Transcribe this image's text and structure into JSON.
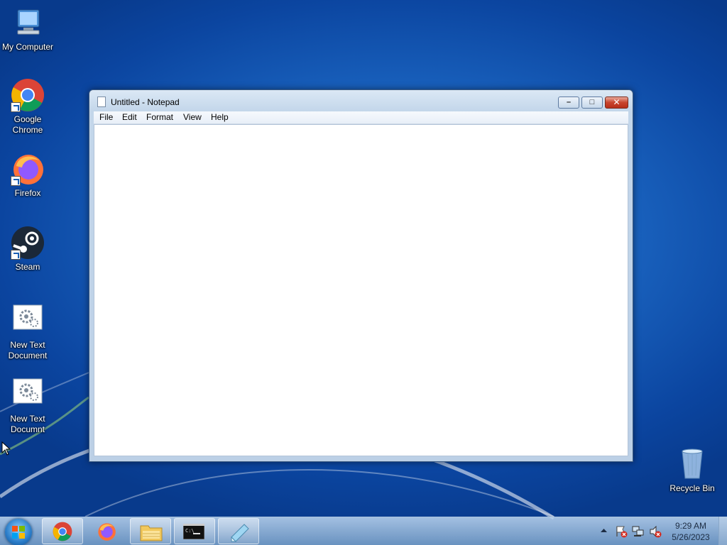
{
  "desktop": {
    "icons": [
      {
        "label": "My Computer"
      },
      {
        "label": "Google Chrome"
      },
      {
        "label": "Firefox"
      },
      {
        "label": "Steam"
      },
      {
        "label": "New Text Document"
      },
      {
        "label": "New Text Documnt"
      },
      {
        "label": "Recycle Bin"
      }
    ]
  },
  "notepad": {
    "title": "Untitled - Notepad",
    "menu": [
      "File",
      "Edit",
      "Format",
      "View",
      "Help"
    ],
    "content": ""
  },
  "taskbar": {
    "time": "9:29 AM",
    "date": "5/26/2023",
    "pinned": [
      "chrome-icon",
      "firefox-icon",
      "explorer-icon",
      "cmd-icon",
      "notepad-icon"
    ]
  },
  "colors": {
    "desktop_bg": "#1a63bf",
    "close_button": "#c8442d"
  }
}
